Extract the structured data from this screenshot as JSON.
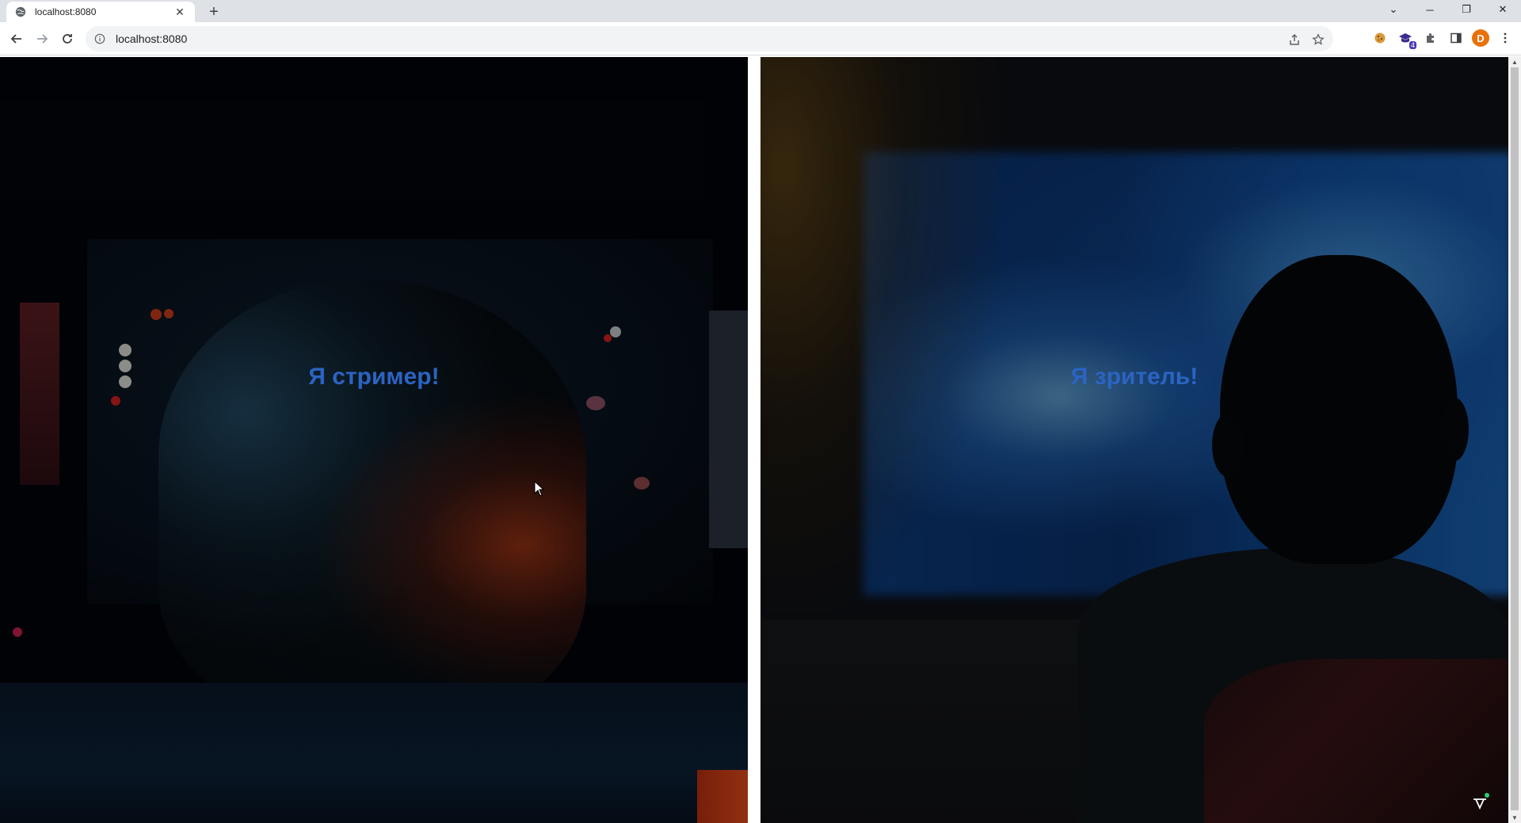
{
  "browser": {
    "tab": {
      "title": "localhost:8080",
      "close": "✕"
    },
    "new_tab": "+",
    "window_controls": {
      "dropdown": "⌄",
      "minimize": "─",
      "restore": "❐",
      "close": "✕"
    },
    "address": "localhost:8080",
    "profile_initial": "D",
    "extension_badge": "4"
  },
  "page": {
    "streamer": {
      "label": "Я стример!"
    },
    "viewer": {
      "label": "Я зритель!"
    }
  },
  "colors": {
    "title_text": "#2b64c2",
    "avatar": "#e8710a",
    "chrome_tabstrip": "#dee1e6",
    "omnibox": "#f1f3f4"
  }
}
